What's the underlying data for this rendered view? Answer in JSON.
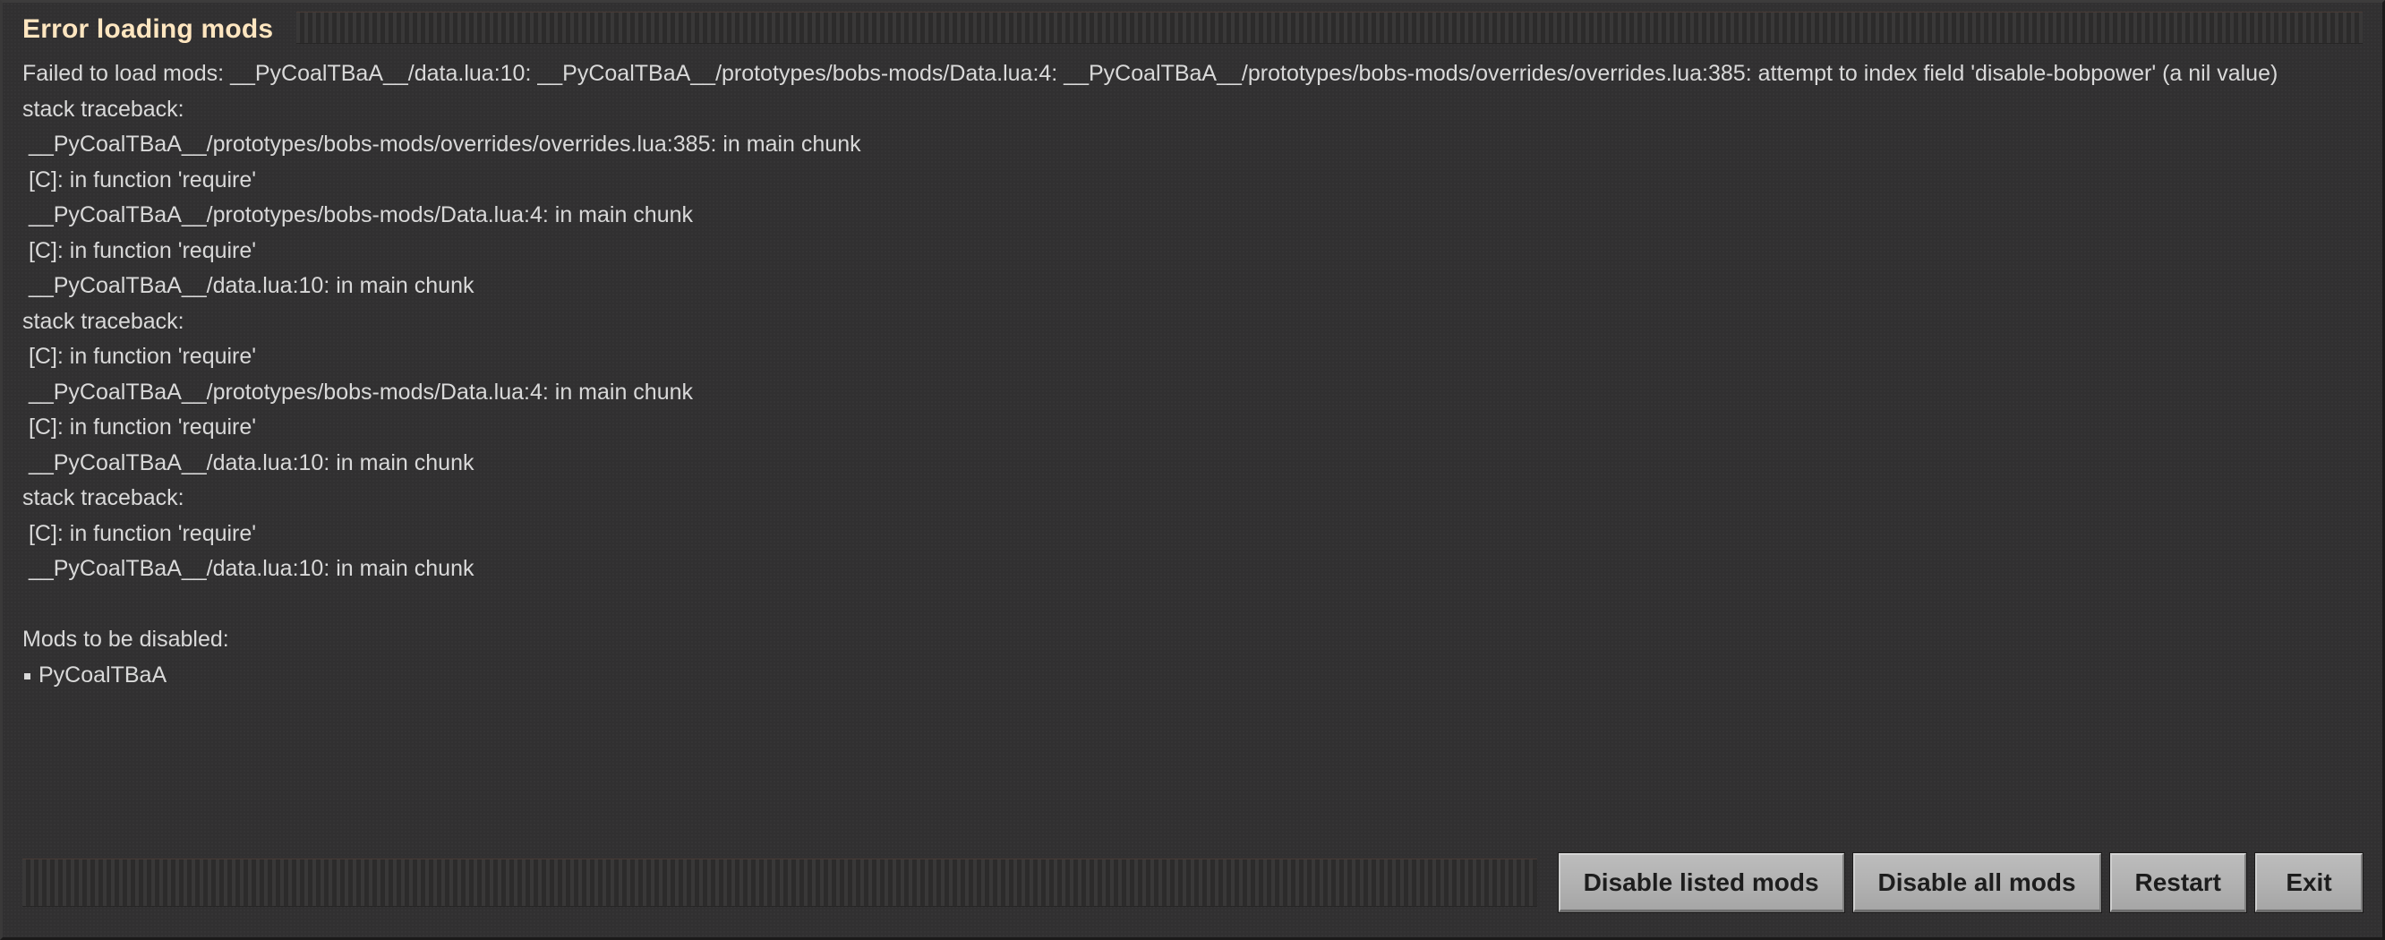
{
  "window": {
    "title": "Error loading mods",
    "title_color": "#ffe6c0",
    "background_color": "#313031",
    "text_color": "#d9d9d9"
  },
  "error": {
    "lines": [
      "Failed to load mods: __PyCoalTBaA__/data.lua:10: __PyCoalTBaA__/prototypes/bobs-mods/Data.lua:4: __PyCoalTBaA__/prototypes/bobs-mods/overrides/overrides.lua:385: attempt to index field 'disable-bobpower' (a nil value)",
      "stack traceback:",
      " __PyCoalTBaA__/prototypes/bobs-mods/overrides/overrides.lua:385: in main chunk",
      " [C]: in function 'require'",
      " __PyCoalTBaA__/prototypes/bobs-mods/Data.lua:4: in main chunk",
      " [C]: in function 'require'",
      " __PyCoalTBaA__/data.lua:10: in main chunk",
      "stack traceback:",
      " [C]: in function 'require'",
      " __PyCoalTBaA__/prototypes/bobs-mods/Data.lua:4: in main chunk",
      " [C]: in function 'require'",
      " __PyCoalTBaA__/data.lua:10: in main chunk",
      "stack traceback:",
      " [C]: in function 'require'",
      " __PyCoalTBaA__/data.lua:10: in main chunk"
    ]
  },
  "mods_to_disable": {
    "heading": "Mods to be disabled:",
    "items": [
      "PyCoalTBaA"
    ]
  },
  "footer": {
    "buttons": [
      {
        "label": "Disable listed mods",
        "name": "disable-listed-mods-button"
      },
      {
        "label": "Disable all mods",
        "name": "disable-all-mods-button"
      },
      {
        "label": "Restart",
        "name": "restart-button"
      },
      {
        "label": "Exit",
        "name": "exit-button"
      }
    ]
  }
}
